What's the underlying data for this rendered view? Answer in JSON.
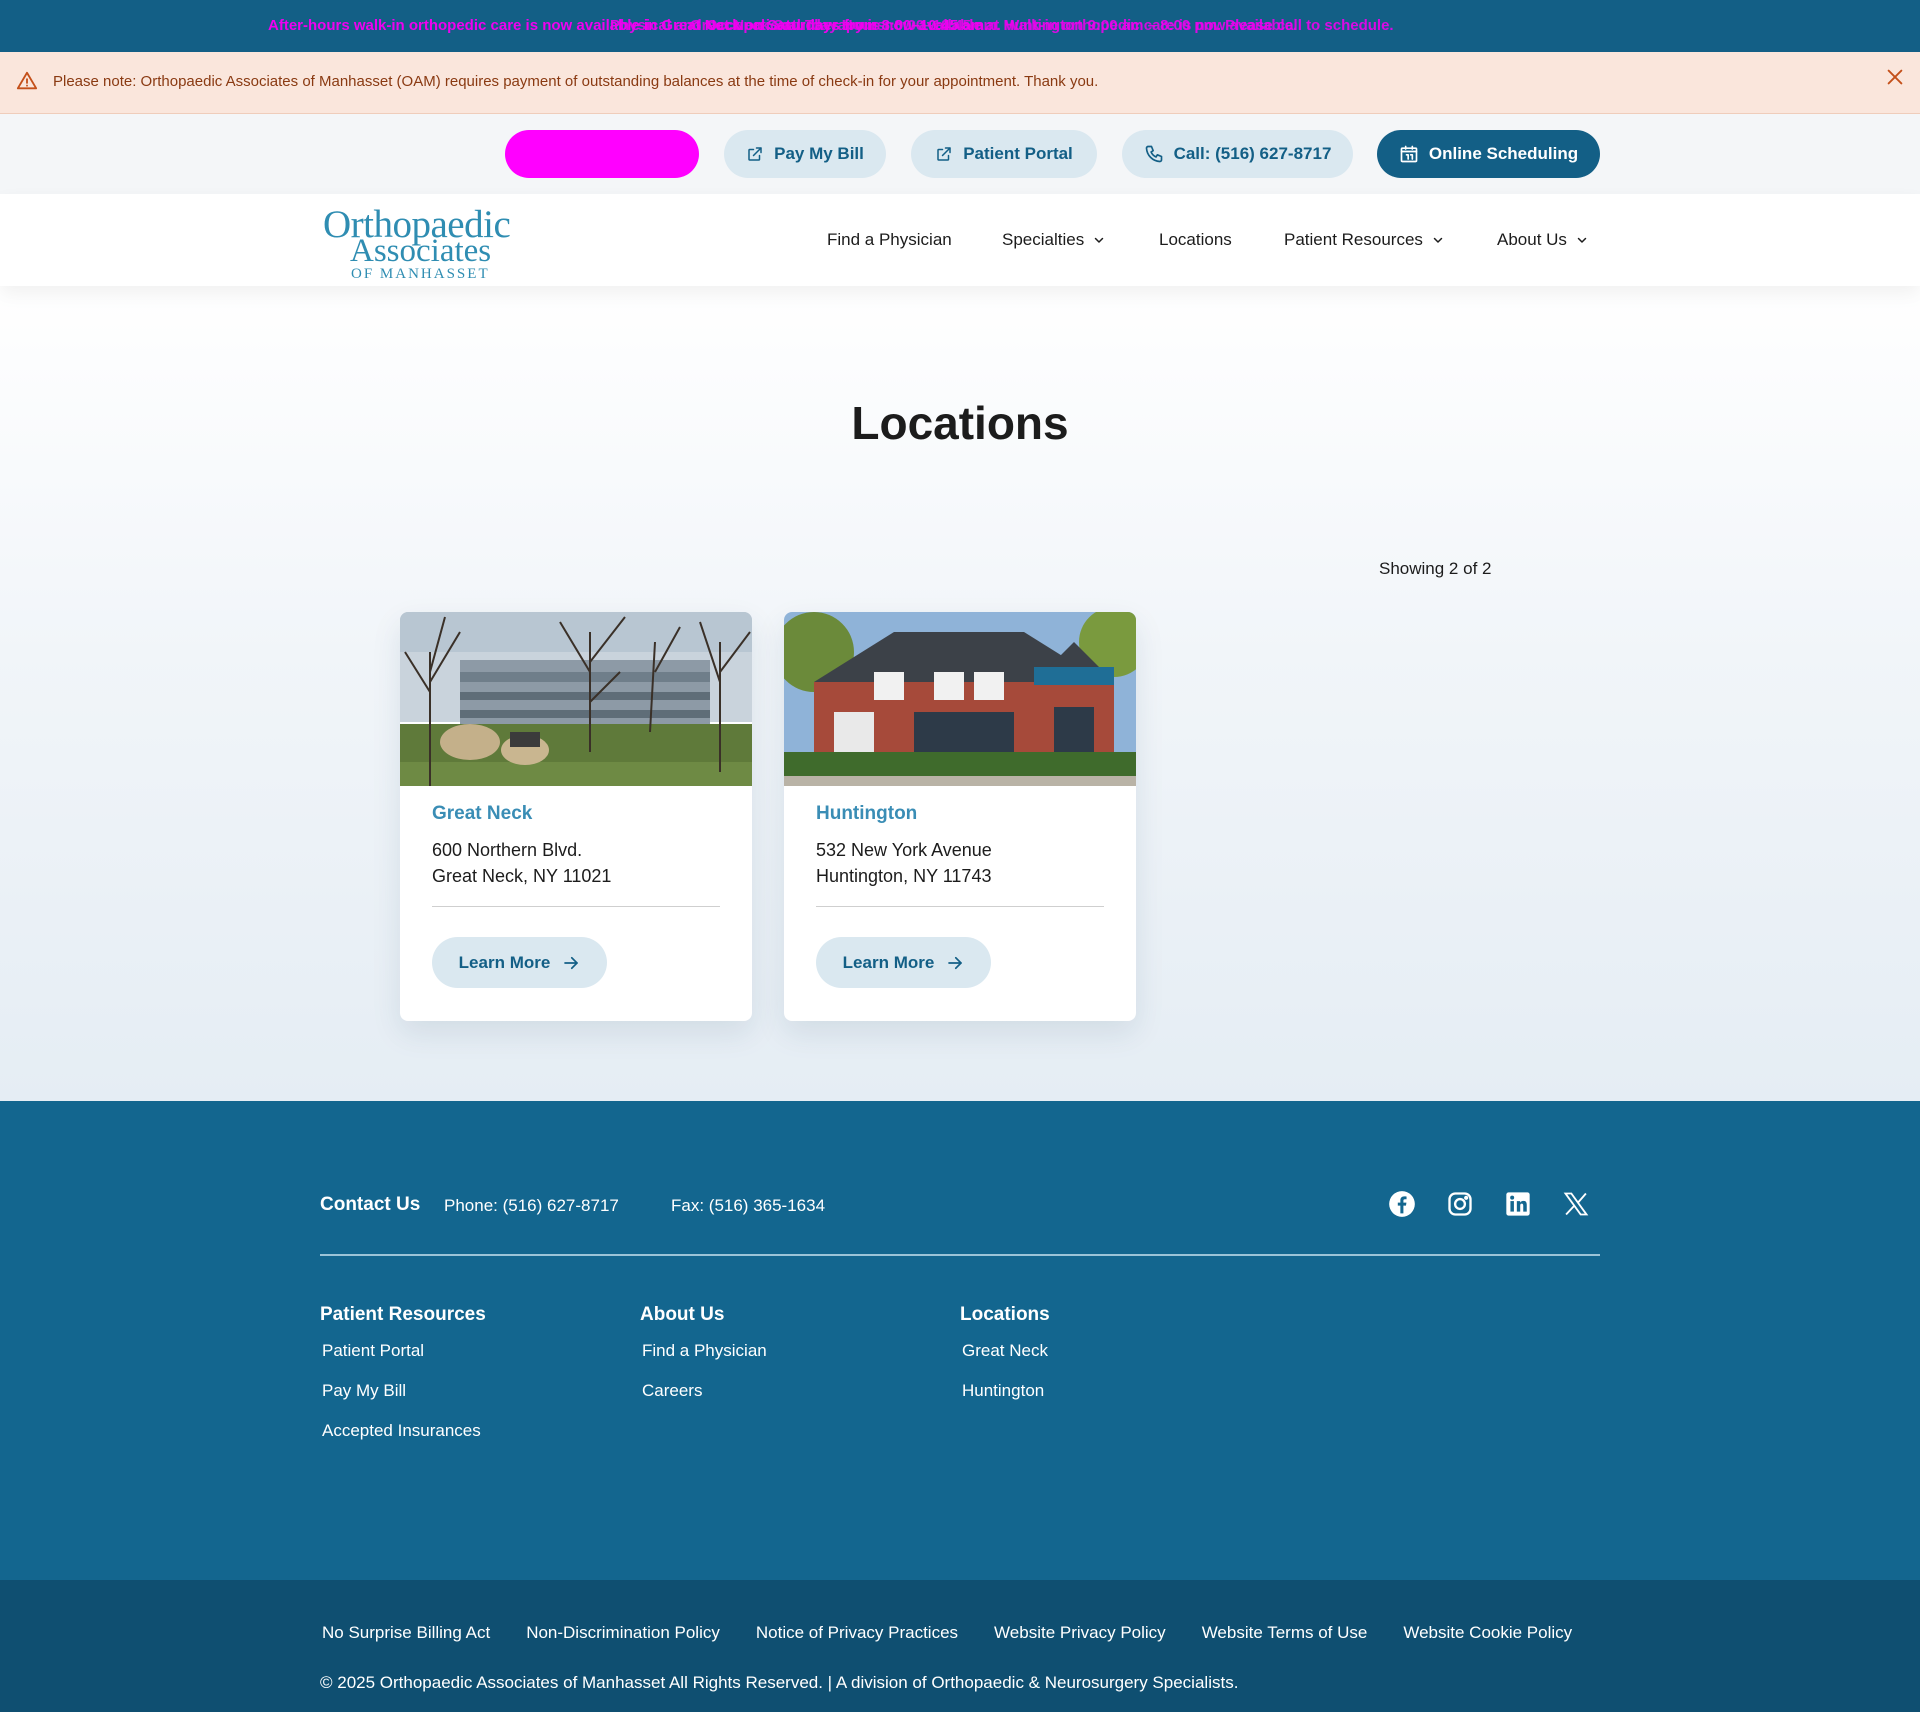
{
  "ticker": {
    "text1": "After-hours walk-in orthopedic care is now available in Great Neck on Saturdays from 8:00–10:45 am.",
    "text2": "Physical and Occupational Therapy is now available at Huntington 9:00 am – 8:00 pm. Please call to schedule.",
    "text3": "Great Neck Saturday Hours: 8:00–10:45 am. Walk-in orthopedic care is now available."
  },
  "alert": {
    "message": "Please note: Orthopaedic Associates of Manhasset (OAM) requires payment of outstanding balances at the time of check-in for your appointment. Thank you.",
    "warning_icon": "warning-triangle-icon",
    "close_icon": "close-x-icon"
  },
  "utility": {
    "pay_bill": "Pay My Bill",
    "patient_portal": "Patient Portal",
    "call": "Call: (516) 627-8717",
    "online_scheduling": "Online Scheduling"
  },
  "logo": {
    "line1": "Orthopaedic",
    "line2": "Associates",
    "line3": "OF MANHASSET"
  },
  "nav": {
    "find_physician": "Find a Physician",
    "specialties": "Specialties",
    "locations": "Locations",
    "patient_resources": "Patient Resources",
    "about_us": "About Us"
  },
  "main": {
    "title": "Locations",
    "showing": "Showing 2 of 2",
    "cards": [
      {
        "name": "Great Neck",
        "address_line1": "600 Northern Blvd.",
        "address_line2": "Great Neck, NY 11021",
        "button": "Learn More"
      },
      {
        "name": "Huntington",
        "address_line1": "532 New York Avenue",
        "address_line2": "Huntington, NY 11743",
        "button": "Learn More"
      }
    ]
  },
  "footer": {
    "contact_title": "Contact Us",
    "phone": "Phone: (516) 627-8717",
    "fax": "Fax: (516) 365-1634",
    "columns": [
      {
        "title": "Patient Resources",
        "links": [
          "Patient Portal",
          "Pay My Bill",
          "Accepted Insurances"
        ]
      },
      {
        "title": "About Us",
        "links": [
          "Find a Physician",
          "Careers"
        ]
      },
      {
        "title": "Locations",
        "links": [
          "Great Neck",
          "Huntington"
        ]
      }
    ]
  },
  "legal": {
    "links": [
      "No Surprise Billing Act",
      "Non-Discrimination Policy",
      "Notice of Privacy Practices",
      "Website Privacy Policy",
      "Website Terms of Use",
      "Website Cookie Policy"
    ],
    "copyright": "© 2025 Orthopaedic Associates of Manhasset All Rights Reserved. | A division of Orthopaedic & Neurosurgery Specialists."
  },
  "colors": {
    "brand_dark": "#135f86",
    "brand_light": "#dae8f0",
    "accent_teal": "#3a8db5",
    "alert_bg": "#fae6dc",
    "highlight_magenta": "#ff00ff"
  }
}
